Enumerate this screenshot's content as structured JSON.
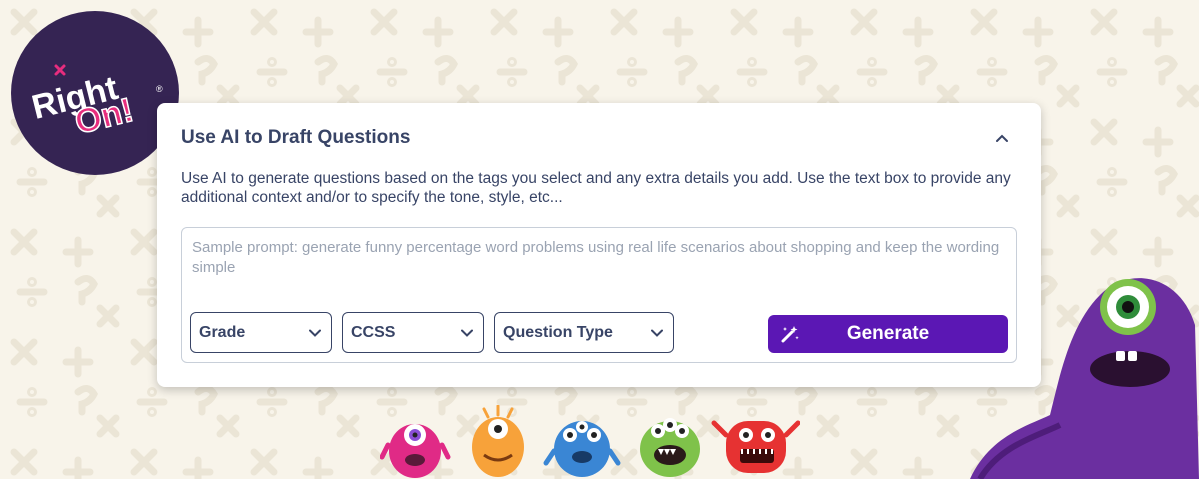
{
  "brand": {
    "logo_text_line1": "Right",
    "logo_text_line2": "On!",
    "logo_mark": "®"
  },
  "panel": {
    "title": "Use AI to Draft Questions",
    "description": "Use AI to generate questions based on the tags you select and any extra details you add. Use the text box to provide any additional context and/or to specify the tone, style, etc...",
    "prompt_placeholder": "Sample prompt: generate funny percentage word problems using real life scenarios about shopping and keep the wording simple",
    "prompt_value": ""
  },
  "filters": {
    "grade_label": "Grade",
    "ccss_label": "CCSS",
    "question_type_label": "Question Type"
  },
  "actions": {
    "generate_label": "Generate"
  },
  "colors": {
    "accent": "#5b17b4",
    "text": "#384466",
    "logo_bg": "#352453",
    "logo_pink": "#e72d7e",
    "background": "#f8f4ea"
  },
  "icons": [
    "collapse-chevron-up-icon",
    "chevron-down-icon",
    "magic-wand-icon"
  ]
}
